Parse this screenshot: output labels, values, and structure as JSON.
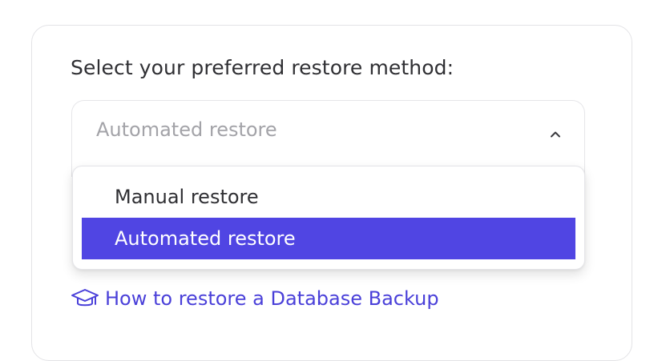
{
  "form": {
    "label": "Select your preferred restore method:",
    "select": {
      "current_value": "Automated restore",
      "expanded": true,
      "chevron_icon": "chevron-up-icon"
    },
    "options": [
      {
        "label": "Manual restore",
        "selected": false
      },
      {
        "label": "Automated restore",
        "selected": true
      }
    ]
  },
  "help_link": {
    "icon": "graduation-cap-icon",
    "label": "How to restore a Database Backup"
  },
  "colors": {
    "accent": "#5045e3",
    "link": "#4a40d9",
    "text": "#2f2f33",
    "placeholder": "#a3a3a8"
  }
}
